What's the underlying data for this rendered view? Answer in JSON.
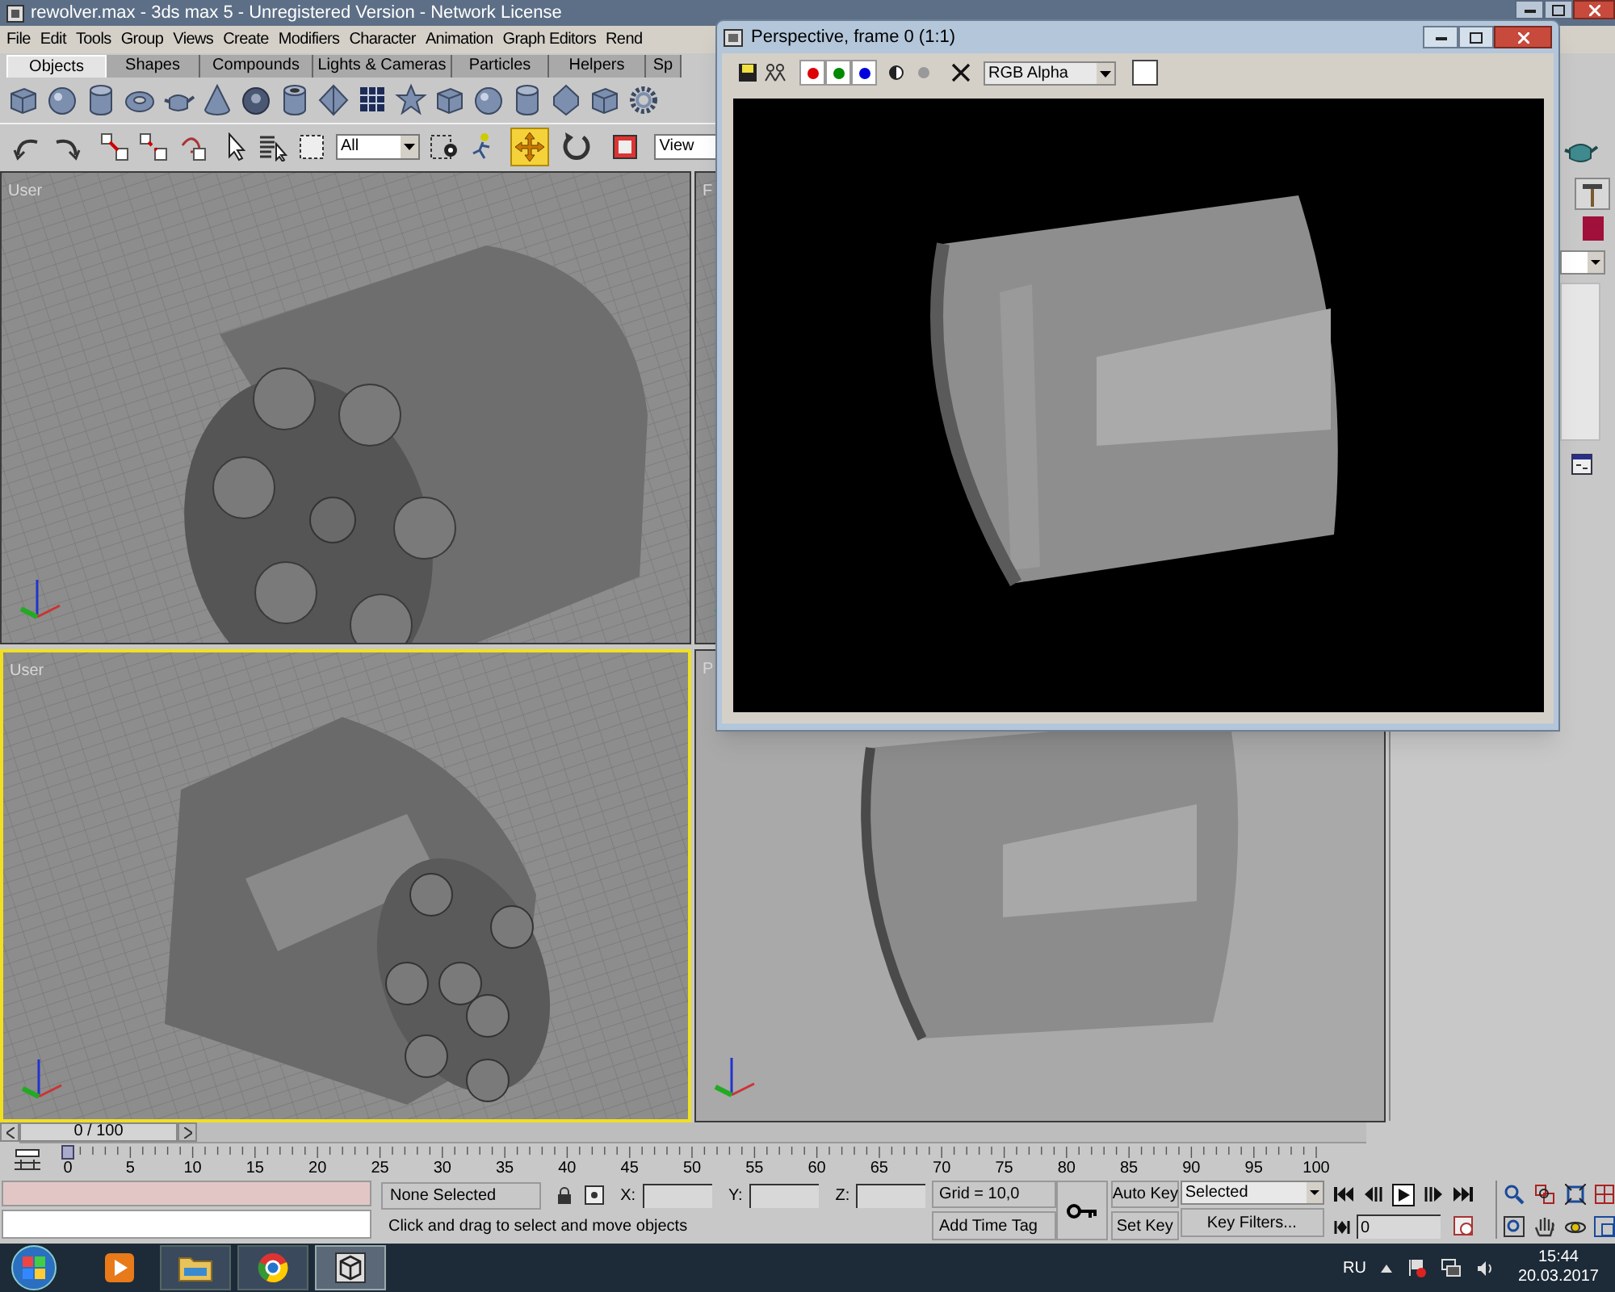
{
  "window": {
    "title": "rewolver.max - 3ds max 5 - Unregistered Version - Network License"
  },
  "menu": [
    "File",
    "Edit",
    "Tools",
    "Group",
    "Views",
    "Create",
    "Modifiers",
    "Character",
    "Animation",
    "Graph Editors",
    "Rend"
  ],
  "create_tabs": [
    {
      "label": "Objects",
      "selected": true
    },
    {
      "label": "Shapes",
      "selected": false
    },
    {
      "label": "Compounds",
      "selected": false
    },
    {
      "label": "Lights & Cameras",
      "selected": false
    },
    {
      "label": "Particles",
      "selected": false
    },
    {
      "label": "Helpers",
      "selected": false
    },
    {
      "label": "Sp",
      "selected": false
    }
  ],
  "main_toolbar": {
    "selection_filter": "All",
    "coordinate_system": "View",
    "tools": [
      {
        "kind": "move",
        "selected": true
      },
      {
        "kind": "rotate",
        "selected": false
      },
      {
        "kind": "scale",
        "selected": false
      }
    ]
  },
  "viewports": [
    {
      "label": "User",
      "active": false,
      "kind": "grid"
    },
    {
      "label": "F",
      "active": false,
      "kind": "grid"
    },
    {
      "label": "User",
      "active": true,
      "kind": "grid"
    },
    {
      "label": "P",
      "active": false,
      "kind": "shaded"
    }
  ],
  "render_window": {
    "title": "Perspective, frame 0 (1:1)",
    "display_mode": "RGB Alpha",
    "channels": [
      {
        "color": "#dd0000",
        "on": true
      },
      {
        "color": "#008a00",
        "on": true
      },
      {
        "color": "#0000dd",
        "on": true
      }
    ]
  },
  "time_slider": {
    "label": "0 / 100"
  },
  "timeline": {
    "ticks": [
      "0",
      "5",
      "10",
      "15",
      "20",
      "25",
      "30",
      "35",
      "40",
      "45",
      "50",
      "55",
      "60",
      "65",
      "70",
      "75",
      "80",
      "85",
      "90",
      "95",
      "100"
    ]
  },
  "status": {
    "selection": "None Selected",
    "coords": [
      "X:",
      "Y:",
      "Z:"
    ],
    "prompt": "Click and drag to select and move objects",
    "grid": "Grid = 10,0",
    "time_tag": "Add Time Tag",
    "auto_key": "Auto Key",
    "set_key": "Set Key",
    "key_mode": "Selected",
    "key_filters": "Key Filters...",
    "frame": "0"
  },
  "taskbar": {
    "language": "RU",
    "time": "15:44",
    "date": "20.03.2017"
  }
}
